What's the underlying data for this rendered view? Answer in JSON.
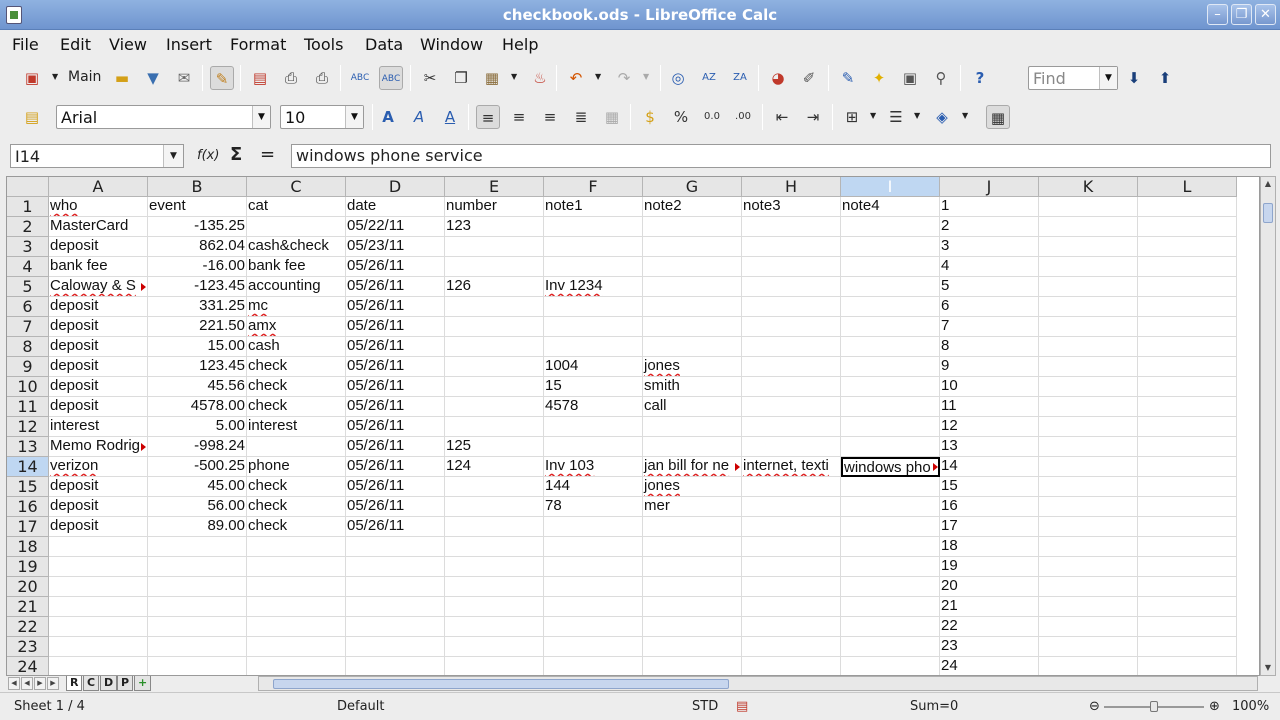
{
  "window": {
    "title": "checkbook.ods - LibreOffice Calc",
    "buttons": [
      "–",
      "❐",
      "✕"
    ]
  },
  "menu": [
    "File",
    "Edit",
    "View",
    "Insert",
    "Format",
    "Tools",
    "Data",
    "Window",
    "Help"
  ],
  "toolbar": {
    "main_label": "Main",
    "find_placeholder": "Find",
    "font_name": "Arial",
    "font_size": "10",
    "icons": [
      "new-document-icon",
      "open-folder-icon",
      "save-icon",
      "email-icon",
      "edit-file-icon",
      "export-pdf-icon",
      "print-icon",
      "print-preview-icon",
      "spellcheck-icon",
      "autospellcheck-icon",
      "cut-icon",
      "copy-icon",
      "paste-icon",
      "clone-formatting-icon",
      "undo-icon",
      "redo-icon",
      "hyperlink-icon",
      "sort-ascending-icon",
      "sort-descending-icon",
      "chart-icon",
      "draw-functions-icon",
      "navigator-icon",
      "gallery-icon",
      "data-sources-icon",
      "zoom-icon",
      "help-icon"
    ]
  },
  "formula_bar": {
    "cell_ref": "I14",
    "content": "windows phone service",
    "function_wizard": "f(x)",
    "sum_symbol": "Σ",
    "equals_symbol": "="
  },
  "columns": [
    "A",
    "B",
    "C",
    "D",
    "E",
    "F",
    "G",
    "H",
    "I",
    "J",
    "K",
    "L"
  ],
  "rows": [
    [
      "who",
      "event",
      "cat",
      "date",
      "number",
      "note1",
      "note2",
      "note3",
      "note4",
      "1"
    ],
    [
      "MasterCard",
      "-135.25",
      "",
      "05/22/11",
      "123",
      "",
      "",
      "",
      "",
      "2"
    ],
    [
      "deposit",
      "862.04",
      "cash&check",
      "05/23/11",
      "",
      "",
      "",
      "",
      "",
      "3"
    ],
    [
      "bank fee",
      "-16.00",
      "bank fee",
      "05/26/11",
      "",
      "",
      "",
      "",
      "",
      "4"
    ],
    [
      "Caloway & S",
      "-123.45",
      "accounting",
      "05/26/11",
      "126",
      "Inv 1234",
      "",
      "",
      "",
      "5"
    ],
    [
      "deposit",
      "331.25",
      "mc",
      "05/26/11",
      "",
      "",
      "",
      "",
      "",
      "6"
    ],
    [
      "deposit",
      "221.50",
      "amx",
      "05/26/11",
      "",
      "",
      "",
      "",
      "",
      "7"
    ],
    [
      "deposit",
      "15.00",
      "cash",
      "05/26/11",
      "",
      "",
      "",
      "",
      "",
      "8"
    ],
    [
      "deposit",
      "123.45",
      "check",
      "05/26/11",
      "",
      "1004",
      "jones",
      "",
      "",
      "9"
    ],
    [
      "deposit",
      "45.56",
      "check",
      "05/26/11",
      "",
      "15",
      "smith",
      "",
      "",
      "10"
    ],
    [
      "deposit",
      "4578.00",
      "check",
      "05/26/11",
      "",
      "4578",
      "call",
      "",
      "",
      "11"
    ],
    [
      "interest",
      "5.00",
      "interest",
      "05/26/11",
      "",
      "",
      "",
      "",
      "",
      "12"
    ],
    [
      "Memo Rodrig",
      "-998.24",
      "",
      "05/26/11",
      "125",
      "",
      "",
      "",
      "",
      "13"
    ],
    [
      "verizon",
      "-500.25",
      "phone",
      "05/26/11",
      "124",
      "Inv 103",
      "jan bill for ne",
      "internet, texti",
      "windows pho",
      "14"
    ],
    [
      "deposit",
      "45.00",
      "check",
      "05/26/11",
      "",
      "144",
      "jones",
      "",
      "",
      "15"
    ],
    [
      "deposit",
      "56.00",
      "check",
      "05/26/11",
      "",
      "78",
      "mer",
      "",
      "",
      "16"
    ],
    [
      "deposit",
      "89.00",
      "check",
      "05/26/11",
      "",
      "",
      "",
      "",
      "",
      "17"
    ],
    [
      "",
      "",
      "",
      "",
      "",
      "",
      "",
      "",
      "",
      "18"
    ],
    [
      "",
      "",
      "",
      "",
      "",
      "",
      "",
      "",
      "",
      "19"
    ],
    [
      "",
      "",
      "",
      "",
      "",
      "",
      "",
      "",
      "",
      "20"
    ],
    [
      "",
      "",
      "",
      "",
      "",
      "",
      "",
      "",
      "",
      "21"
    ],
    [
      "",
      "",
      "",
      "",
      "",
      "",
      "",
      "",
      "",
      "22"
    ],
    [
      "",
      "",
      "",
      "",
      "",
      "",
      "",
      "",
      "",
      "23"
    ],
    [
      "",
      "",
      "",
      "",
      "",
      "",
      "",
      "",
      "",
      "24"
    ]
  ],
  "active_cell": "I14",
  "sheet_tabs": [
    "R",
    "C",
    "D",
    "P"
  ],
  "status": {
    "sheet": "Sheet 1 / 4",
    "style": "Default",
    "mode": "STD",
    "sum": "Sum=0",
    "zoom": "100%"
  }
}
